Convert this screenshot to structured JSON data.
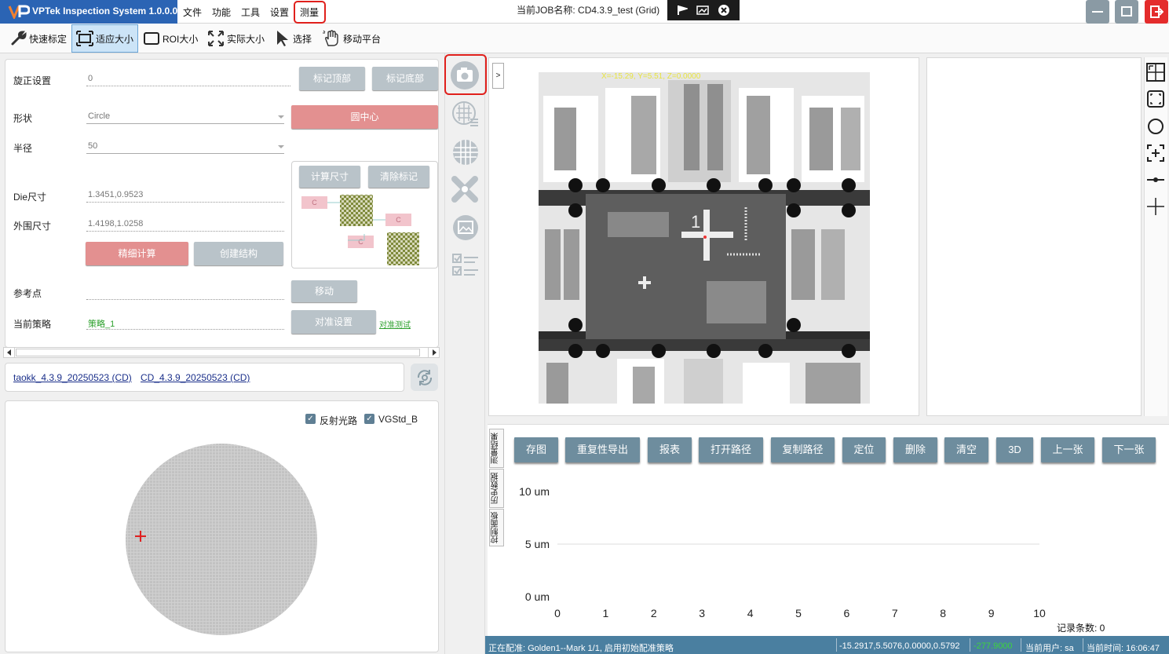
{
  "app": {
    "title": "VPTek Inspection System 1.0.0.0",
    "job_label": "当前JOB名称:",
    "job_name": "CD4.3.9_test (Grid)"
  },
  "menu": [
    "文件",
    "功能",
    "工具",
    "设置",
    "测量"
  ],
  "toolbar": {
    "quick_calib": "快速标定",
    "fit_size": "适应大小",
    "roi_size": "ROI大小",
    "actual_size": "实际大小",
    "select": "选择",
    "move_stage": "移动平台"
  },
  "settings": {
    "rotation_label": "旋正设置",
    "rotation_value": "0",
    "mark_top": "标记顶部",
    "mark_bottom": "标记底部",
    "shape_label": "形状",
    "shape_value": "Circle",
    "circle_center": "圆中心",
    "radius_label": "半径",
    "radius_value": "50",
    "calc_size": "计算尺寸",
    "clear_mark": "清除标记",
    "die_label": "Die尺寸",
    "die_value": "1.3451,0.9523",
    "outer_label": "外围尺寸",
    "outer_value": "1.4198,1.0258",
    "fine_calc": "精细计算",
    "create_struct": "创建结构",
    "ref_label": "参考点",
    "move": "移动",
    "strategy_label": "当前策略",
    "strategy_value": "策略_1",
    "align_settings": "对准设置",
    "align_test": "对准测试",
    "chip_label": "C"
  },
  "links": [
    "taokk_4.3.9_20250523 (CD)",
    "CD_4.3.9_20250523 (CD)"
  ],
  "wafer": {
    "checkbox1": "反射光路",
    "checkbox2": "VGStd_B",
    "checkbox1_checked": true,
    "checkbox2_checked": true
  },
  "image": {
    "overlay_text": "X=-15.29, Y=5.51, Z=0.0000",
    "die_number": "1"
  },
  "results": {
    "vtabs": [
      "测量结果",
      "历史数据",
      "控制面板"
    ],
    "buttons": [
      "存图",
      "重复性导出",
      "报表",
      "打开路径",
      "复制路径",
      "定位",
      "删除",
      "清空",
      "3D",
      "上一张",
      "下一张"
    ],
    "record_count": "记录条数: 0"
  },
  "chart_data": {
    "type": "line",
    "title": "",
    "xlabel": "",
    "ylabel": "",
    "x_ticks": [
      "0",
      "1",
      "2",
      "3",
      "4",
      "5",
      "6",
      "7",
      "8",
      "9",
      "10"
    ],
    "y_ticks": [
      "10 um",
      "5 um",
      "0 um"
    ],
    "xlim": [
      0,
      10
    ],
    "ylim": [
      0,
      10
    ],
    "series": [],
    "grid": "horizontal"
  },
  "status": {
    "left": "正在配准: Golden1--Mark 1/1,  启用初始配准策略",
    "coords": "-15.2917,5.5076,0.0000,0.5792",
    "green_value": "-277.9000",
    "user": "当前用户: sa",
    "time": "当前时间: 16:06:47"
  },
  "colors": {
    "accent_blue": "#2b64b4",
    "highlight_red": "#e0201c",
    "result_button": "#6e8d9e",
    "status_bar": "#4a7fa0",
    "green_text": "#2ca02c"
  }
}
